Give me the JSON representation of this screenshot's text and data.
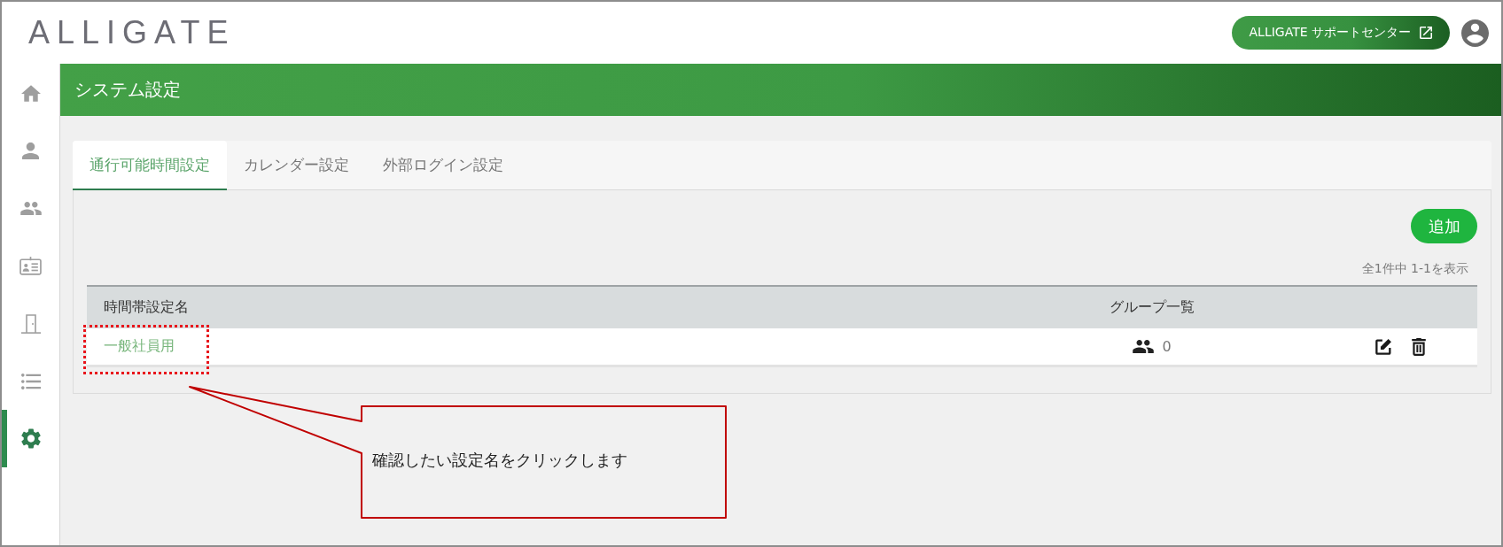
{
  "header": {
    "logo": "ALLIGATE",
    "support_button": {
      "label": "ALLIGATE サポートセンター"
    }
  },
  "sidebar": {
    "items": [
      {
        "kind": "home",
        "selected": false
      },
      {
        "kind": "person",
        "selected": false
      },
      {
        "kind": "people",
        "selected": false
      },
      {
        "kind": "card",
        "selected": false
      },
      {
        "kind": "door",
        "selected": false
      },
      {
        "kind": "list",
        "selected": false
      },
      {
        "kind": "settings",
        "selected": true
      }
    ]
  },
  "page": {
    "title": "システム設定"
  },
  "tabs": [
    {
      "label": "通行可能時間設定",
      "selected": true
    },
    {
      "label": "カレンダー設定",
      "selected": false
    },
    {
      "label": "外部ログイン設定",
      "selected": false
    }
  ],
  "toolbar": {
    "add_button": "追加",
    "count": "全1件中 1-1を表示"
  },
  "table": {
    "columns": [
      "時間帯設定名",
      "グループ一覧"
    ],
    "rows": [
      {
        "name": "一般社員用",
        "groups": "0",
        "highlighted": true
      }
    ]
  },
  "annotation": {
    "callout": "確認したい設定名をクリックします"
  }
}
